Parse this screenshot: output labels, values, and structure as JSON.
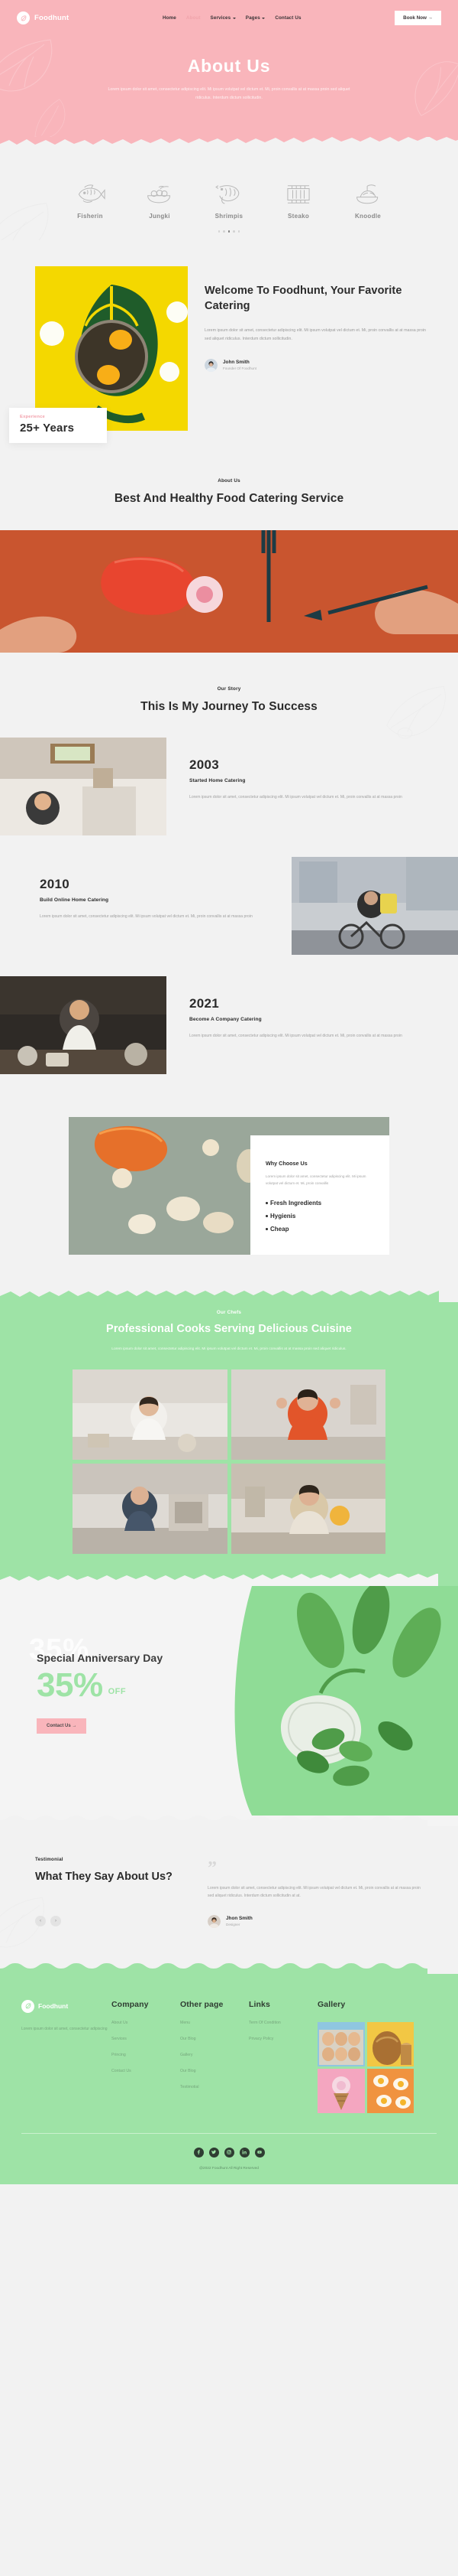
{
  "brand": {
    "name": "Foodhunt",
    "logo_icon": "leaf-logo-icon"
  },
  "nav": {
    "items": [
      {
        "label": "Home",
        "has_dropdown": false,
        "state": "default"
      },
      {
        "label": "About",
        "has_dropdown": false,
        "state": "active"
      },
      {
        "label": "Services",
        "has_dropdown": true,
        "state": "default"
      },
      {
        "label": "Pages",
        "has_dropdown": true,
        "state": "default"
      },
      {
        "label": "Contact Us",
        "has_dropdown": false,
        "state": "default"
      }
    ],
    "cta_label": "Book Now →"
  },
  "hero": {
    "title": "About Us",
    "subtitle": "Lorem ipsum dolor sit amet, consectetur adipiscing elit. Mi ipsum volutpat vel dictum et. Mi, proin convallis at at massa proin sed aliquet ridiculus. Interdum dictum sollicitudin."
  },
  "categories": {
    "items": [
      {
        "label": "Fisherin",
        "icon": "fish-icon"
      },
      {
        "label": "Jungki",
        "icon": "bowl-icon"
      },
      {
        "label": "Shrimpis",
        "icon": "shrimp-icon"
      },
      {
        "label": "Steako",
        "icon": "steak-grill-icon"
      },
      {
        "label": "Knoodle",
        "icon": "noodles-icon"
      }
    ],
    "carousel_dots": 5,
    "active_dot": 3
  },
  "welcome": {
    "heading": "Welcome To Foodhunt, Your Favorite Catering",
    "paragraph": "Lorem ipsum dolor sit amet, consectetur adipiscing elit. Mi ipsum volutpat vel dictum et. Mi, proin convallis at at massa proin sed aliquet ridiculus. Interdum dictum sollicitudin.",
    "badge": {
      "label": "Experience",
      "value": "25+ Years"
    },
    "author": {
      "name": "John Smith",
      "role": "Founder Of Foodhunt"
    }
  },
  "about_head": {
    "eyebrow": "About Us",
    "heading": "Best And Healthy Food Catering Service"
  },
  "journey": {
    "eyebrow": "Our Story",
    "heading": "This Is My Journey To Success",
    "milestones": [
      {
        "year": "2003",
        "title": "Started Home Catering",
        "text": "Lorem ipsum dolor sit amet, consectetur adipiscing elit. Mi ipsum volutpat vel dictum et. Mi, proin convallis at at massa proin"
      },
      {
        "year": "2010",
        "title": "Build Online Home Catering",
        "text": "Lorem ipsum dolor sit amet, consectetur adipiscing elit. Mi ipsum volutpat vel dictum et. Mi, proin convallis at at massa proin"
      },
      {
        "year": "2021",
        "title": "Become A Company Catering",
        "text": "Lorem ipsum dolor sit amet, consectetur adipiscing elit. Mi ipsum volutpat vel dictum et. Mi, proin convallis at at massa proin"
      }
    ]
  },
  "why_choose": {
    "title": "Why Choose Us",
    "paragraph": "Lorem ipsum dolor sit amet, consectetur adipiscing elit. Mi ipsum volutpat vel dictum et. Mi, proin convallis",
    "bullets": [
      "Fresh Ingredients",
      "Hygienis",
      "Cheap"
    ]
  },
  "chefs": {
    "eyebrow": "Our Chefs",
    "heading": "Professional Cooks Serving Delicious Cuisine",
    "paragraph": "Lorem ipsum dolor sit amet, consectetur adipiscing elit. Mi ipsum volutpat vel dictum et. Mi, proin convallis at at massa proin sed aliquet ridiculus."
  },
  "anniversary": {
    "ghost_text": "35%",
    "title": "Special Anniversary Day",
    "percent": "35%",
    "off_label": "OFF",
    "cta_label": "Contact Us →"
  },
  "testimonial": {
    "eyebrow": "Testimonial",
    "heading": "What They Say About Us?",
    "quote_mark": "”",
    "paragraph": "Lorem ipsum dolor sit amet, consectetur adipiscing elit. Mi ipsum volutpat vel dictum et. Mi, proin convallis at at massa proin sed aliquet ridiculus. Interdum dictum sollicitudin at at.",
    "author": {
      "name": "Jhon Smith",
      "role": "Designer"
    },
    "prev_icon": "arrow-left-icon",
    "next_icon": "arrow-right-icon"
  },
  "footer": {
    "brand_name": "Foodhunt",
    "brand_text": "Lorem ipsum dolor sit amet, consectetur adipiscing",
    "columns": [
      {
        "heading": "Company",
        "links": [
          "About Us",
          "Services",
          "Princing",
          "Contact Us"
        ]
      },
      {
        "heading": "Other page",
        "links": [
          "Menu",
          "Our Blog",
          "Gallery",
          "Our Blog",
          "Testimotial"
        ]
      },
      {
        "heading": "Links",
        "links": [
          "Term Of Condition",
          "Privacy Policy"
        ]
      }
    ],
    "gallery_heading": "Gallery",
    "socials": [
      "facebook-icon",
      "twitter-icon",
      "instagram-icon",
      "linkedin-icon",
      "youtube-icon"
    ],
    "copyright": "@2022 Foodhunt All Right Reserved"
  },
  "colors": {
    "pink": "#f9b5bb",
    "green": "#9ee3a6",
    "orange_band": "#c9552f",
    "page_bg": "#f2f2f2",
    "dark": "#2b2b2b"
  }
}
